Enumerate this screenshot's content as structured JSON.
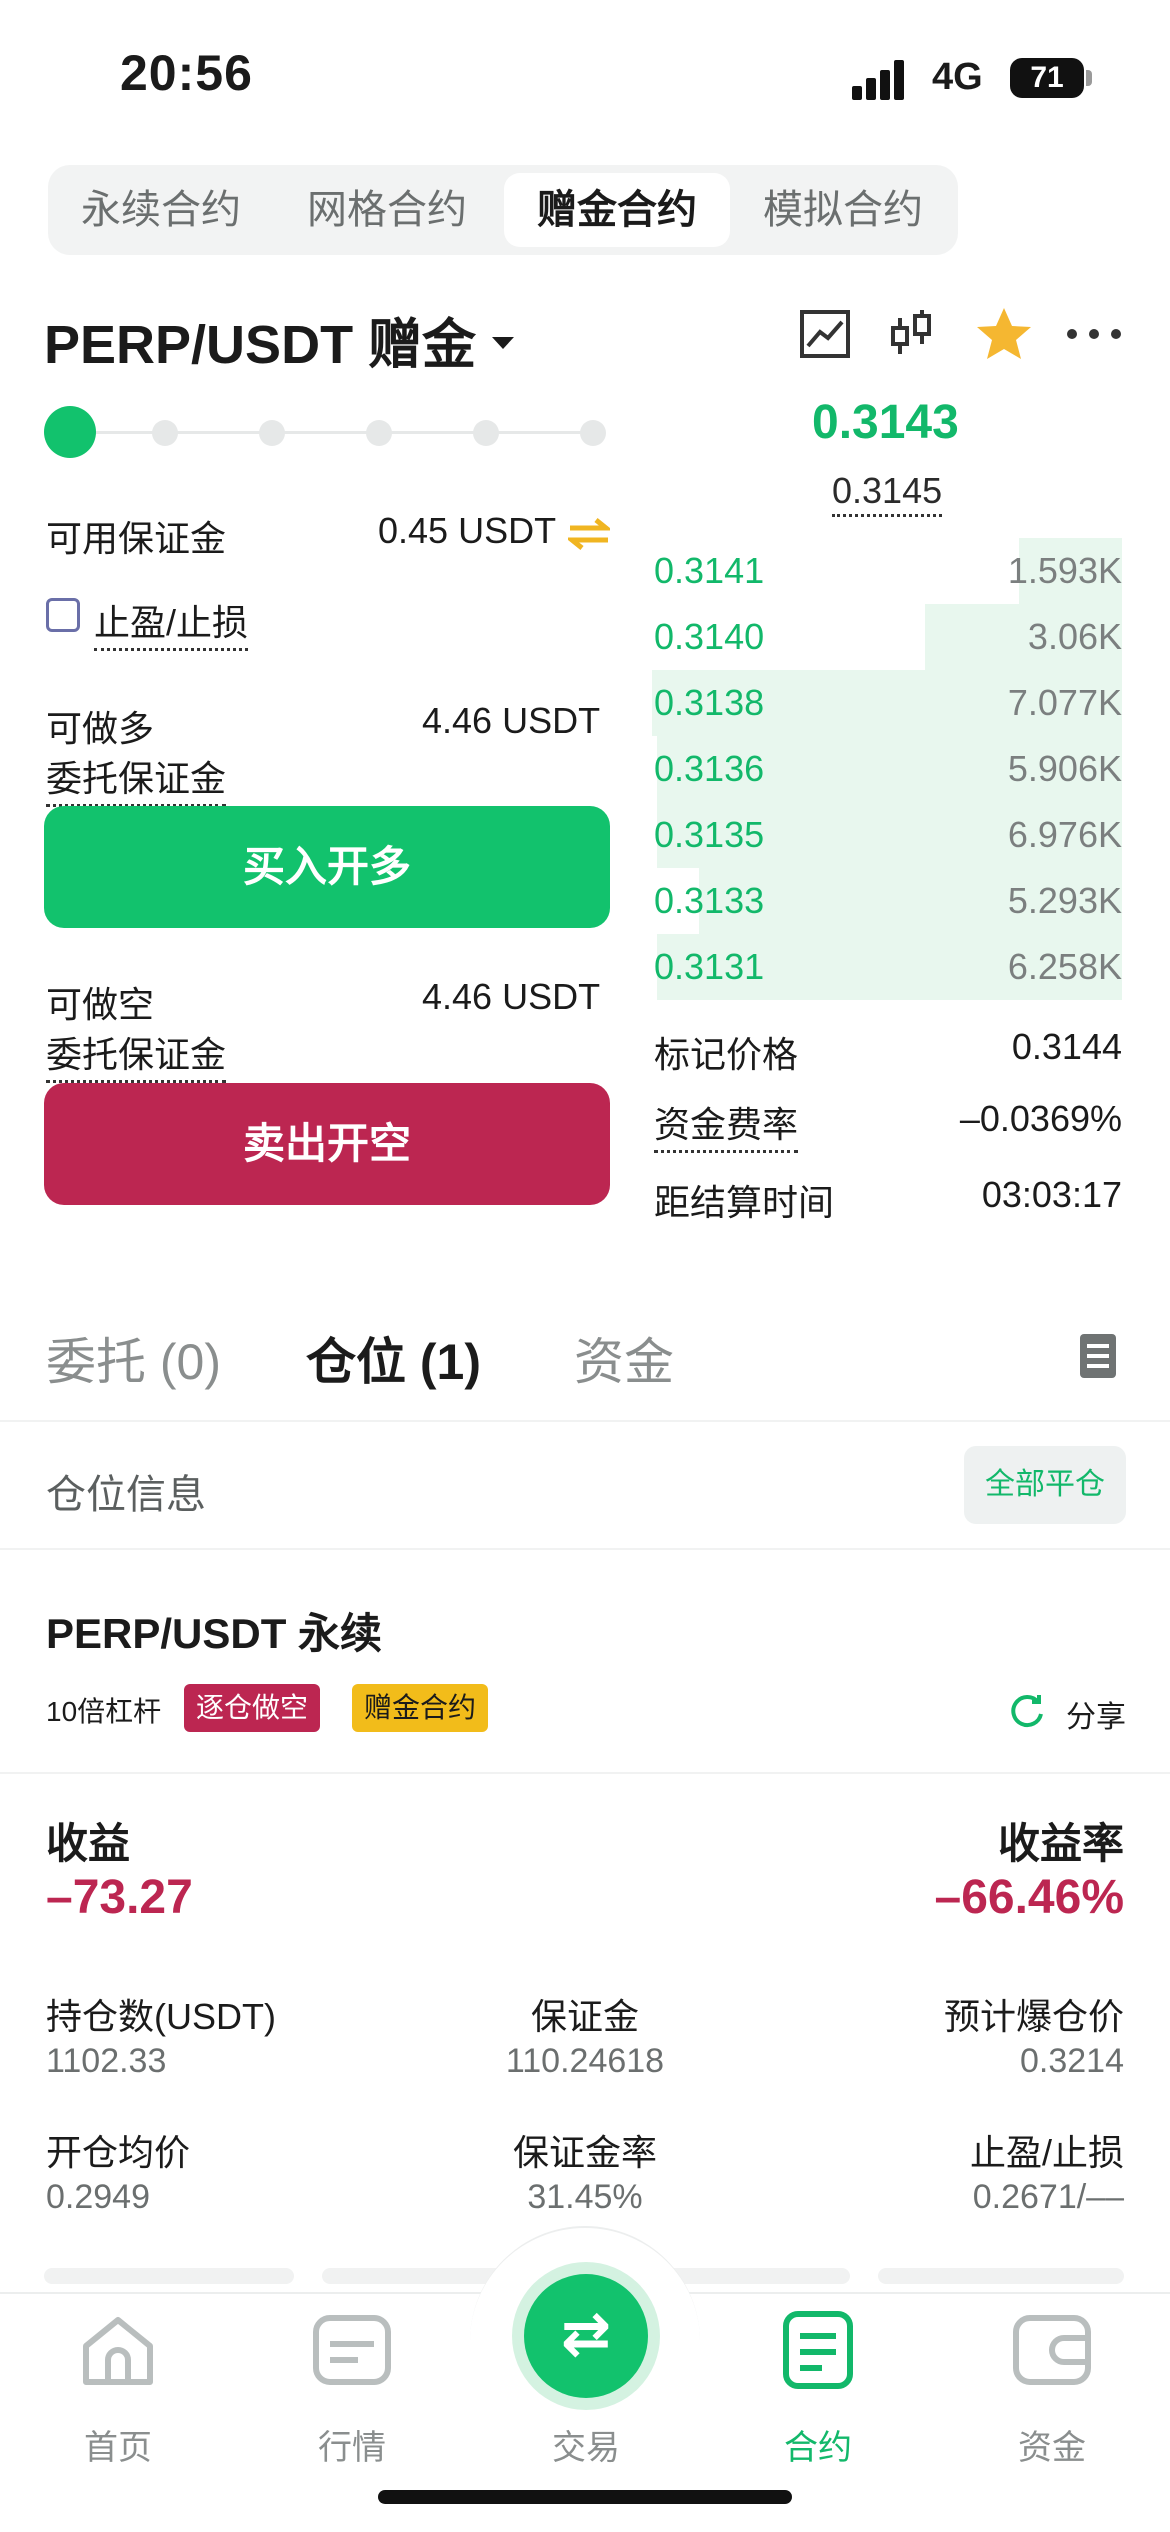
{
  "status": {
    "time": "20:56",
    "network": "4G",
    "battery": "71"
  },
  "top_tabs": [
    "永续合约",
    "网格合约",
    "赠金合约",
    "模拟合约"
  ],
  "pair": {
    "name": "PERP/USDT 赠金"
  },
  "icons": {
    "chart": "line-chart-icon",
    "kline": "candlestick-icon",
    "favorite": "star-icon",
    "more": "more-dots-icon"
  },
  "colors": {
    "green": "#12c26d",
    "red": "#bc2651",
    "star": "#f5b731",
    "yellow_badge": "#f2bc1a"
  },
  "leverage_slider": {
    "value_pct": 0
  },
  "form": {
    "available_label": "可用保证金",
    "available_value": "0.45 USDT",
    "tpsl_label": "止盈/止损",
    "tpsl_checked": false,
    "long_label": "可做多",
    "long_value": "4.46 USDT",
    "long_margin_label": "委托保证金",
    "buy_button": "买入开多",
    "short_label": "可做空",
    "short_value": "4.46 USDT",
    "short_margin_label": "委托保证金",
    "sell_button": "卖出开空"
  },
  "orderbook": {
    "last_price": "0.3143",
    "mark_hint": "0.3145",
    "rows": [
      {
        "price": "0.3141",
        "qty": "1.593K",
        "depth": 0.22
      },
      {
        "price": "0.3140",
        "qty": "3.06K",
        "depth": 0.42
      },
      {
        "price": "0.3138",
        "qty": "7.077K",
        "depth": 1.0
      },
      {
        "price": "0.3136",
        "qty": "5.906K",
        "depth": 0.99
      },
      {
        "price": "0.3135",
        "qty": "6.976K",
        "depth": 0.99
      },
      {
        "price": "0.3133",
        "qty": "5.293K",
        "depth": 0.9
      },
      {
        "price": "0.3131",
        "qty": "6.258K",
        "depth": 0.99
      }
    ]
  },
  "market_info": {
    "mark_price_label": "标记价格",
    "mark_price": "0.3144",
    "funding_label": "资金费率",
    "funding_rate": "–0.0369%",
    "settle_label": "距结算时间",
    "settle_time": "03:03:17"
  },
  "section_tabs": {
    "orders": "委托 (0)",
    "positions": "仓位 (1)",
    "funds": "资金"
  },
  "position_header": {
    "title": "仓位信息",
    "close_all": "全部平仓"
  },
  "position": {
    "symbol": "PERP/USDT 永续",
    "leverage": "10倍杠杆",
    "mode_badge": "逐仓做空",
    "type_badge": "赠金合约",
    "share": "分享",
    "pnl_label": "收益",
    "pnl": "–73.27",
    "roe_label": "收益率",
    "roe": "–66.46%",
    "size_label": "持仓数(USDT)",
    "size": "1102.33",
    "margin_label": "保证金",
    "margin": "110.24618",
    "liq_label": "预计爆仓价",
    "liq": "0.3214",
    "entry_label": "开仓均价",
    "entry": "0.2949",
    "margin_ratio_label": "保证金率",
    "margin_ratio": "31.45%",
    "tpsl_label": "止盈/止损",
    "tpsl": "0.2671/––"
  },
  "bottom_nav": [
    "首页",
    "行情",
    "交易",
    "合约",
    "资金"
  ]
}
